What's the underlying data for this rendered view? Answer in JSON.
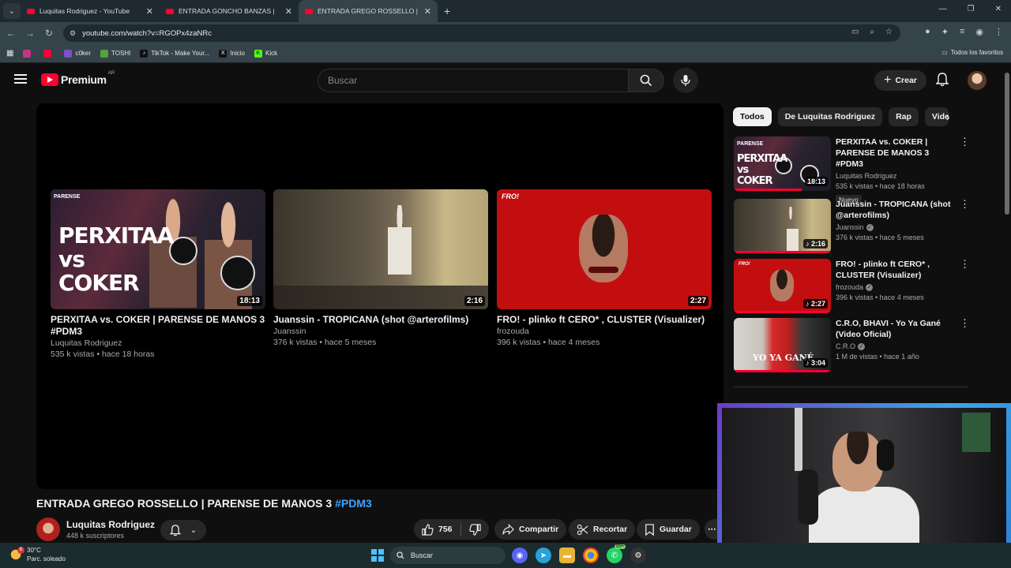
{
  "browser": {
    "tabs": [
      {
        "title": "Luquitas Rodriguez - YouTube",
        "active": false
      },
      {
        "title": "ENTRADA GONCHO BANZAS |",
        "active": false
      },
      {
        "title": "ENTRADA GREGO ROSSELLO |",
        "active": true
      }
    ],
    "url": "youtube.com/watch?v=RGOPx4zaNRc",
    "bookmarks": [
      "c0ker",
      "TOSHI",
      "TikTok - Make Your...",
      "Inicio",
      "Kick"
    ],
    "all_bookmarks": "Todos los favoritos"
  },
  "header": {
    "logo_text": "Premium",
    "country": "AR",
    "search_placeholder": "Buscar",
    "create_label": "Crear"
  },
  "end_screen": [
    {
      "title": "PERXITAA vs. COKER | PARENSE DE MANOS 3 #PDM3",
      "channel": "Luquitas Rodriguez",
      "meta": "535 k vistas • hace 18 horas",
      "duration": "18:13",
      "thumb_text": "PERXITAA vs COKER"
    },
    {
      "title": "Juanssin - TROPICANA (shot @arterofilms)",
      "channel": "Juanssin",
      "meta": "376 k vistas • hace 5 meses",
      "duration": "2:16"
    },
    {
      "title": "FRO! - plinko ft CERO* , CLUSTER (Visualizer)",
      "channel": "frozouda",
      "meta": "396 k vistas • hace 4 meses",
      "duration": "2:27",
      "thumb_text": "FRO!"
    }
  ],
  "video": {
    "title": "ENTRADA GREGO ROSSELLO | PARENSE DE MANOS 3 ",
    "hashtag": "#PDM3",
    "channel": "Luquitas Rodriguez",
    "subscribers": "448 k suscriptores",
    "likes": "756",
    "share_label": "Compartir",
    "clip_label": "Recortar",
    "save_label": "Guardar"
  },
  "sidebar": {
    "chips": [
      "Todos",
      "De Luquitas Rodriguez",
      "Rap",
      "Video"
    ],
    "recommendations": [
      {
        "title": "PERXITAA vs. COKER  |  PARENSE DE MANOS 3 #PDM3",
        "channel": "Luquitas Rodriguez",
        "meta": "535 k vistas • hace 18 horas",
        "duration": "18:13",
        "badge": "Nuevo",
        "verified": false
      },
      {
        "title": "Juanssin - TROPICANA (shot @arterofilms)",
        "channel": "Juanssin",
        "meta": "376 k vistas • hace 5 meses",
        "duration": "2:16",
        "verified": true
      },
      {
        "title": "FRO! - plinko ft CERO* , CLUSTER (Visualizer)",
        "channel": "frozouda",
        "meta": "396 k vistas • hace 4 meses",
        "duration": "2:27",
        "verified": true
      },
      {
        "title": "C.R.O, BHAVI - Yo Ya Gané (Video Oficial)",
        "channel": "C.R.O",
        "meta": "1 M de vistas • hace 1 año",
        "duration": "3:04",
        "verified": true,
        "thumb_text": "YO YA GANÉ"
      }
    ]
  },
  "taskbar": {
    "temperature": "30°C",
    "weather": "Parc. soleado",
    "weather_badge": "6",
    "search_placeholder": "Buscar",
    "whatsapp_badge": "99+"
  },
  "colors": {
    "accent": "#ff0033",
    "link": "#3ea6ff",
    "background": "#0f0f0f"
  }
}
